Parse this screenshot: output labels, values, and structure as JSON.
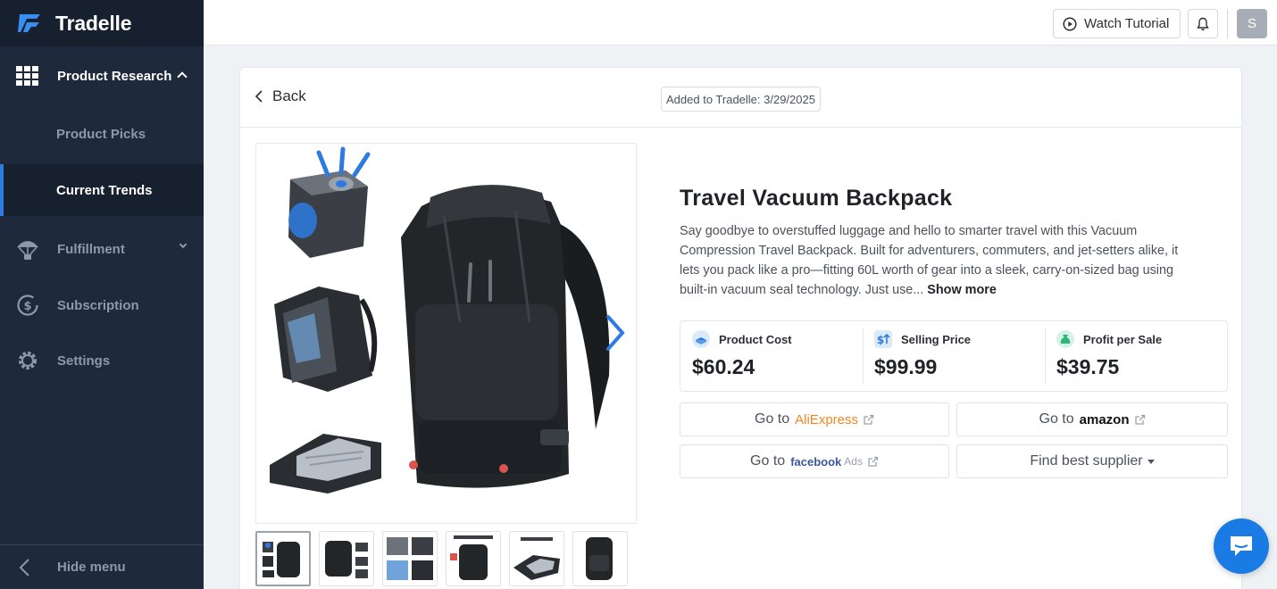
{
  "app": {
    "name": "Tradelle"
  },
  "sidebar": {
    "product_research": {
      "label": "Product Research",
      "icon": "grid-icon"
    },
    "sub_items": [
      {
        "label": "Product Picks",
        "active": false
      },
      {
        "label": "Current Trends",
        "active": true
      }
    ],
    "fulfillment": {
      "label": "Fulfillment",
      "icon": "parachute-icon"
    },
    "subscription": {
      "label": "Subscription",
      "icon": "dollar-cycle-icon"
    },
    "settings": {
      "label": "Settings",
      "icon": "gear-icon"
    },
    "hide_menu": {
      "label": "Hide menu",
      "icon": "chevron-left-icon"
    }
  },
  "topbar": {
    "watch_tutorial": "Watch Tutorial",
    "avatar_initial": "S"
  },
  "product": {
    "back_label": "Back",
    "added": "Added to Tradelle: 3/29/2025",
    "title": "Travel Vacuum Backpack",
    "description": "Say goodbye to overstuffed luggage and hello to smarter travel with this Vacuum Compression Travel Backpack. Built for adventurers, commuters, and jet-setters alike, it lets you pack like a pro—fitting 60L worth of gear into a sleek, carry-on-sized bag using built-in vacuum seal technology. Just use...",
    "show_more": "Show more",
    "stats": [
      {
        "label": "Product Cost",
        "value": "$60.24",
        "icon": "box-icon"
      },
      {
        "label": "Selling Price",
        "value": "$99.99",
        "icon": "dollar-up-icon"
      },
      {
        "label": "Profit per Sale",
        "value": "$39.75",
        "icon": "money-bag-icon"
      }
    ],
    "links": {
      "go_to": "Go to",
      "aliexpress": "AliExpress",
      "amazon": "amazon",
      "facebook": "facebook",
      "facebook_ads": "Ads",
      "find_supplier": "Find best supplier"
    },
    "thumbnail_count": 6
  },
  "colors": {
    "sidebar_bg": "#1e2a3c",
    "accent": "#2f7ce0",
    "chat": "#1b7be4"
  }
}
